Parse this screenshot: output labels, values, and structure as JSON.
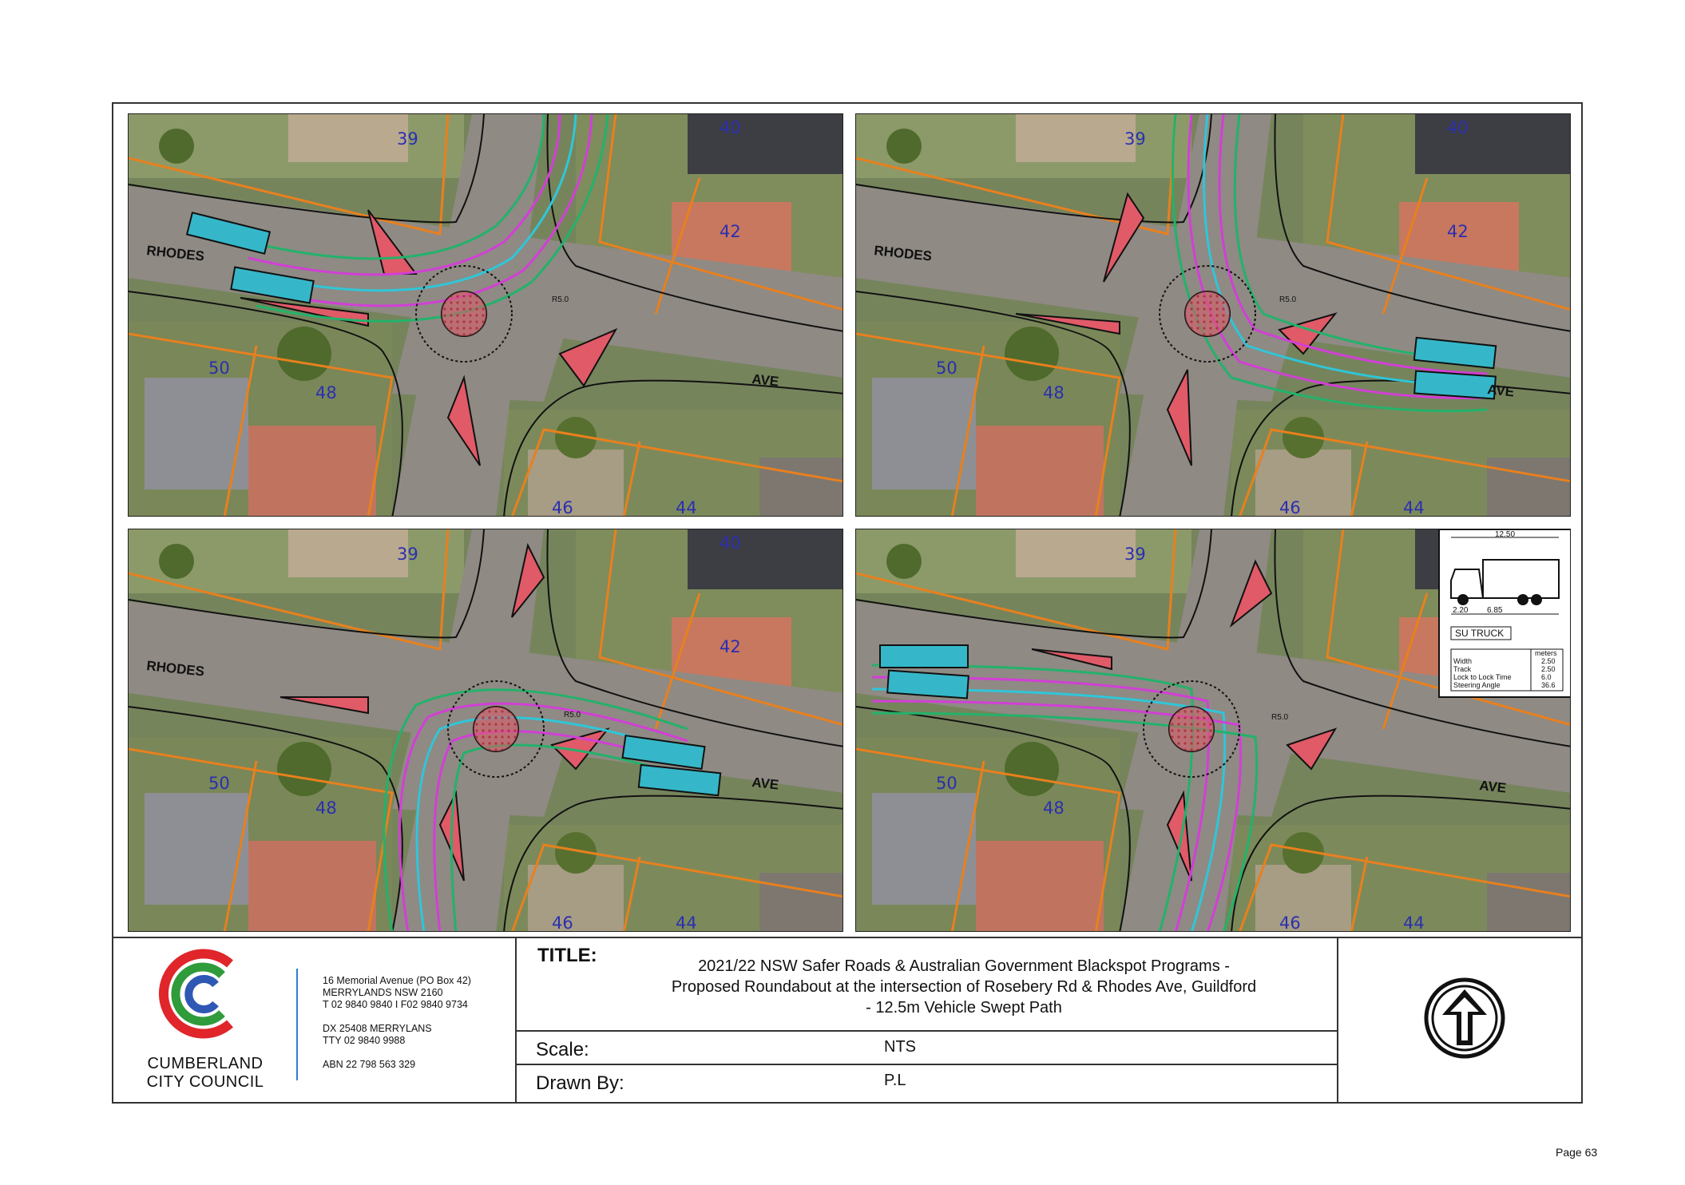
{
  "panels": {
    "lots": [
      "39",
      "40",
      "42",
      "50",
      "48",
      "46",
      "44"
    ],
    "street_rhodes": "RHODES",
    "street_ave": "AVE",
    "radius_label": "R5.0"
  },
  "vehicle_spec": {
    "dimension_top": "12.50",
    "dimension_front": "2.20",
    "dimension_wheelbase": "6.85",
    "name": "SU TRUCK",
    "units_header": "meters",
    "rows": [
      {
        "label": "Width",
        "value": "2.50"
      },
      {
        "label": "Track",
        "value": "2.50"
      },
      {
        "label": "Lock to Lock Time",
        "value": "6.0"
      },
      {
        "label": "Steering Angle",
        "value": "36.6"
      }
    ]
  },
  "council": {
    "name_line1": "CUMBERLAND",
    "name_line2": "CITY COUNCIL",
    "address": [
      "16 Memorial Avenue (PO Box 42)",
      "MERRYLANDS NSW 2160",
      "T 02 9840 9840 I  F02 9840 9734",
      "",
      "DX 25408 MERRYLANS",
      "TTY 02 9840 9988",
      "",
      "ABN 22 798 563 329"
    ],
    "logo_colors": {
      "red": "#e0262a",
      "green": "#2f9b3a",
      "blue": "#2f58b5"
    }
  },
  "title_block": {
    "title_label": "TITLE:",
    "title_line1": "2021/22 NSW Safer Roads & Australian Government Blackspot Programs  -",
    "title_line2": "Proposed Roundabout at the intersection of Rosebery Rd & Rhodes Ave, Guildford",
    "title_line3": "- 12.5m Vehicle Swept Path",
    "scale_label": "Scale:",
    "scale_value": "NTS",
    "drawn_label": "Drawn By:",
    "drawn_value": "P.L"
  },
  "page_number": "Page 63",
  "colors": {
    "path_magenta": "#d23fd6",
    "path_green": "#23b26b",
    "path_cyan": "#2fc6d8",
    "lot_boundary": "#e8801e",
    "island_fill": "#e05a68"
  }
}
